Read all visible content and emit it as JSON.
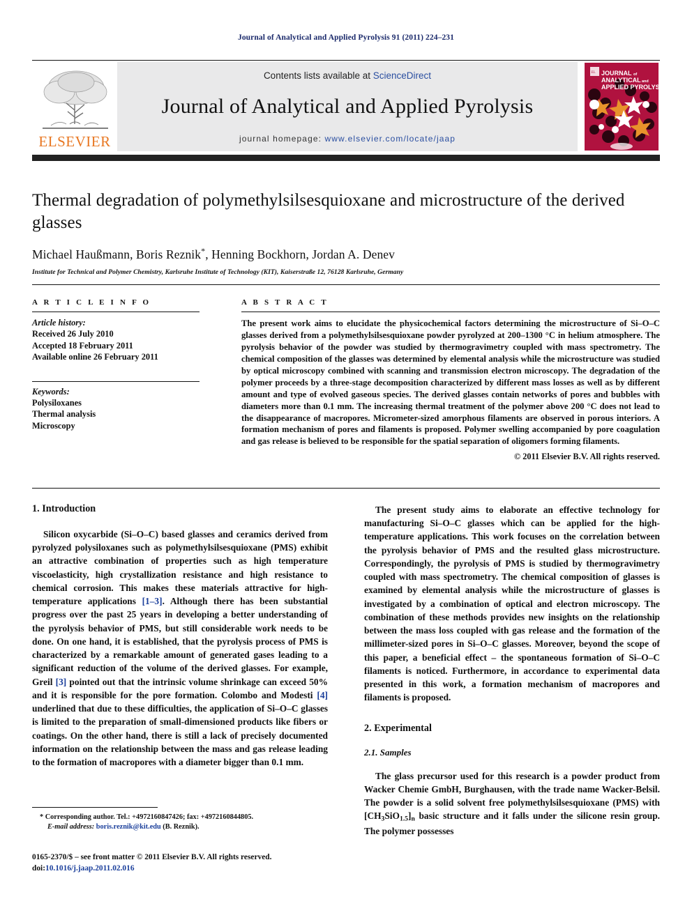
{
  "running_head": "Journal of Analytical and Applied Pyrolysis 91 (2011) 224–231",
  "masthead": {
    "publisher_name": "ELSEVIER",
    "contents_prefix": "Contents lists available at ",
    "contents_link": "ScienceDirect",
    "journal_name": "Journal of Analytical and Applied Pyrolysis",
    "homepage_prefix": "journal homepage: ",
    "homepage_url": "www.elsevier.com/locate/jaap",
    "cover": {
      "line1": "JOURNAL of",
      "line2": "ANALYTICAL and",
      "line3": "APPLIED PYROLYSIS",
      "bg_color": "#b0123f",
      "accent_color": "#e8922b"
    }
  },
  "article": {
    "title": "Thermal degradation of polymethylsilsesquioxane and microstructure of the derived glasses",
    "authors": "Michael Haußmann, Boris Reznik",
    "authors_tail": ", Henning Bockhorn, Jordan A. Denev",
    "corresponding_marker": "*",
    "affiliation": "Institute for Technical and Polymer Chemistry, Karlsruhe Institute of Technology (KIT), Kaiserstraße 12, 76128 Karlsruhe, Germany"
  },
  "article_info": {
    "kicker": "A R T I C L E   I N F O",
    "history_label": "Article history:",
    "history": [
      "Received 26 July 2010",
      "Accepted 18 February 2011",
      "Available online 26 February 2011"
    ],
    "keywords_label": "Keywords:",
    "keywords": [
      "Polysiloxanes",
      "Thermal analysis",
      "Microscopy"
    ]
  },
  "abstract": {
    "kicker": "A B S T R A C T",
    "text": "The present work aims to elucidate the physicochemical factors determining the microstructure of Si–O–C glasses derived from a polymethylsilsesquioxane powder pyrolyzed at 200–1300 °C in helium atmosphere. The pyrolysis behavior of the powder was studied by thermogravimetry coupled with mass spectrometry. The chemical composition of the glasses was determined by elemental analysis while the microstructure was studied by optical microscopy combined with scanning and transmission electron microscopy. The degradation of the polymer proceeds by a three-stage decomposition characterized by different mass losses as well as by different amount and type of evolved gaseous species. The derived glasses contain networks of pores and bubbles with diameters more than 0.1 mm. The increasing thermal treatment of the polymer above 200 °C does not lead to the disappearance of macropores. Micrometer-sized amorphous filaments are observed in porous interiors. A formation mechanism of pores and filaments is proposed. Polymer swelling accompanied by pore coagulation and gas release is believed to be responsible for the spatial separation of oligomers forming filaments.",
    "copyright": "© 2011 Elsevier B.V. All rights reserved."
  },
  "sections": {
    "introduction_heading": "1.  Introduction",
    "intro_para_1_a": "Silicon oxycarbide (Si–O–C) based glasses and ceramics derived from pyrolyzed polysiloxanes such as polymethylsilsesquioxane (PMS) exhibit an attractive combination of properties such as high temperature viscoelasticity, high crystallization resistance and high resistance to chemical corrosion. This makes these materials attractive for high-temperature applications ",
    "intro_ref_1": "[1–3]",
    "intro_para_1_b": ". Although there has been substantial progress over the past 25 years in developing a better understanding of the pyrolysis behavior of PMS, but still considerable work needs to be done. On one hand, it is established, that the pyrolysis process of PMS is characterized by a remarkable amount of generated gases leading to a significant reduction of the volume of the derived glasses. For example, Greil ",
    "intro_ref_2": "[3]",
    "intro_para_1_c": " pointed out that the intrinsic volume shrinkage can exceed 50% and it is responsible for the pore formation. Colombo and Modesti ",
    "intro_ref_3": "[4]",
    "intro_para_1_d": " underlined that due to these difficulties, the application of Si–O–C glasses is limited to the preparation of small-dimensioned products like fibers or coatings. On the other hand, there is still a lack of precisely documented information on the relationship between the mass and gas release leading to the formation of macropores with a diameter bigger than 0.1 mm.",
    "right_para_1": "The present study aims to elaborate an effective technology for manufacturing Si–O–C glasses which can be applied for the high-temperature applications. This work focuses on the correlation between the pyrolysis behavior of PMS and the resulted glass microstructure. Correspondingly, the pyrolysis of PMS is studied by thermogravimetry coupled with mass spectrometry. The chemical composition of glasses is examined by elemental analysis while the microstructure of glasses is investigated by a combination of optical and electron microscopy. The combination of these methods provides new insights on the relationship between the mass loss coupled with gas release and the formation of the millimeter-sized pores in Si–O–C glasses. Moreover, beyond the scope of this paper, a beneficial effect – the spontaneous formation of Si–O–C filaments is noticed. Furthermore, in accordance to experimental data presented in this work, a formation mechanism of macropores and filaments is proposed.",
    "experimental_heading": "2.  Experimental",
    "samples_heading": "2.1.  Samples",
    "samples_para_a": "The glass precursor used for this research is a powder product from Wacker Chemie GmbH, Burghausen, with the trade name Wacker-Belsil. The powder is a solid solvent free polymethylsilsesquioxane (PMS) with [CH",
    "samples_sub_1": "3",
    "samples_para_b": "SiO",
    "samples_sub_2": "1.5",
    "samples_para_c": "]",
    "samples_sub_3": "n",
    "samples_para_d": " basic structure and it falls under the silicone resin group. The polymer possesses"
  },
  "footnotes": {
    "corresponding": "* Corresponding author. Tel.: +4972160847426; fax: +4972160844805.",
    "email_label": "E-mail address:",
    "email": "boris.reznik@kit.edu",
    "email_tail": " (B. Reznik).",
    "imprint_line": "0165-2370/$ – see front matter © 2011 Elsevier B.V. All rights reserved.",
    "doi_label": "doi:",
    "doi_value": "10.1016/j.jaap.2011.02.016"
  }
}
